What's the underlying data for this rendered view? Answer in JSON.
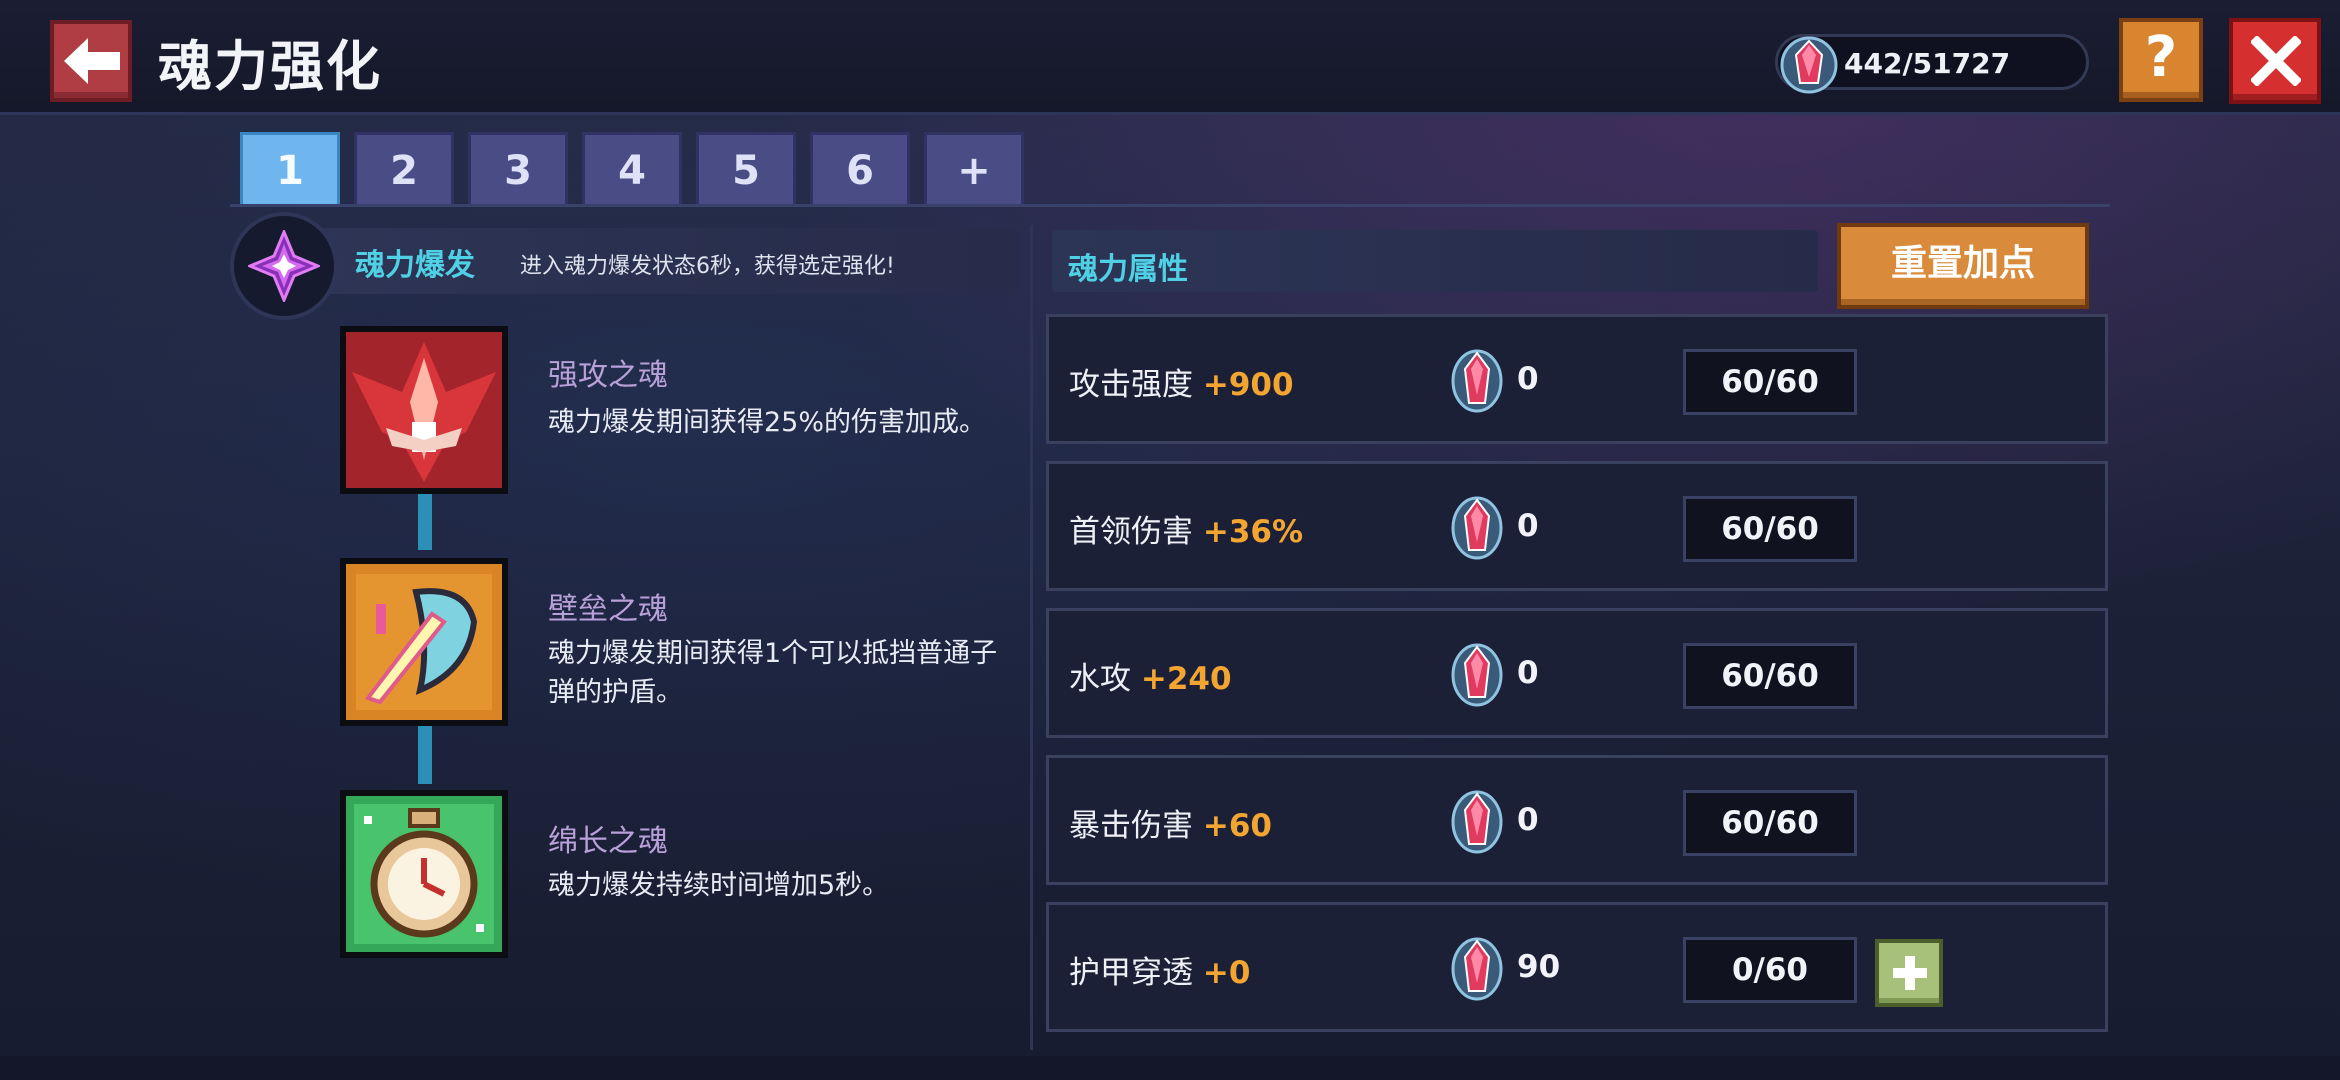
{
  "header": {
    "title": "魂力强化",
    "currency": "442/51727"
  },
  "tabs": [
    "1",
    "2",
    "3",
    "4",
    "5",
    "6",
    "+"
  ],
  "active_tab": "1",
  "burst": {
    "title": "魂力爆发",
    "description": "进入魂力爆发状态6秒，获得选定强化!"
  },
  "skills": [
    {
      "name": "强攻之魂",
      "description": "魂力爆发期间获得25%的伤害加成。",
      "icon": "red-winged-fighter-icon"
    },
    {
      "name": "壁垒之魂",
      "description": "魂力爆发期间获得1个可以抵挡普通子弹的护盾。",
      "icon": "shield-sword-icon"
    },
    {
      "name": "绵长之魂",
      "description": "魂力爆发持续时间增加5秒。",
      "icon": "stopwatch-icon"
    }
  ],
  "attributes": {
    "title": "魂力属性",
    "reset_label": "重置加点",
    "rows": [
      {
        "name": "攻击强度",
        "bonus": "+900",
        "cost": "0",
        "level": "60/60"
      },
      {
        "name": "首领伤害",
        "bonus": "+36%",
        "cost": "0",
        "level": "60/60"
      },
      {
        "name": "水攻",
        "bonus": "+240",
        "cost": "0",
        "level": "60/60"
      },
      {
        "name": "暴击伤害",
        "bonus": "+60",
        "cost": "0",
        "level": "60/60"
      },
      {
        "name": "护甲穿透",
        "bonus": "+0",
        "cost": "90",
        "level": "0/60"
      }
    ]
  },
  "colors": {
    "accent_cyan": "#4fd0e4",
    "bonus_orange": "#f3a531",
    "tab_active": "#6fb6ef",
    "tab_inactive": "#4a4c86",
    "reset_button": "#d98b3b",
    "close_button": "#d52f30"
  }
}
